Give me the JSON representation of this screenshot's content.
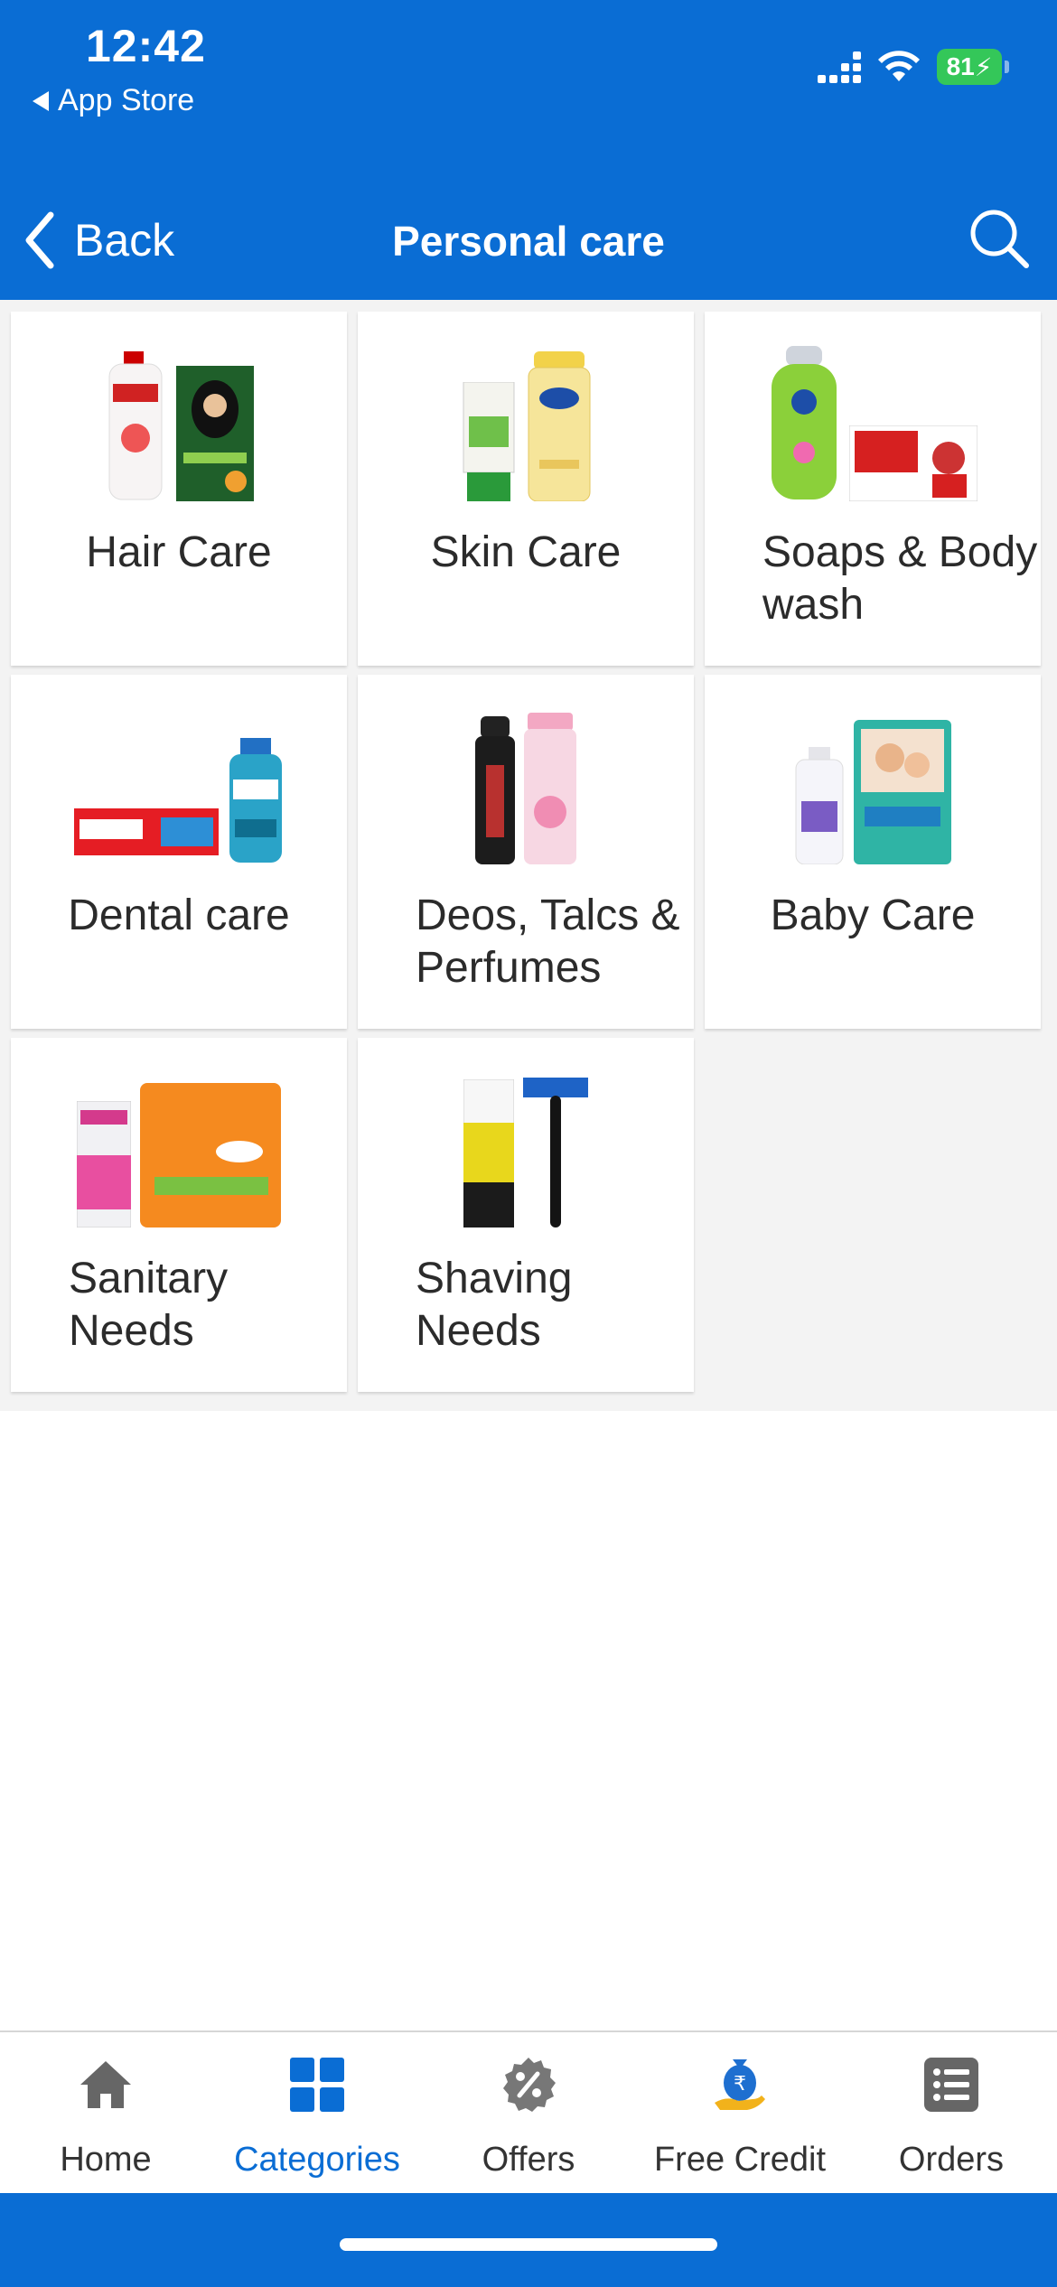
{
  "status_bar": {
    "time": "12:42",
    "back_app": "App Store",
    "battery": "81"
  },
  "navbar": {
    "back_label": "Back",
    "title": "Personal care",
    "search_icon": "search-icon"
  },
  "categories": [
    {
      "label": "Hair Care"
    },
    {
      "label": "Skin Care"
    },
    {
      "label": "Soaps & Body wash"
    },
    {
      "label": "Dental care"
    },
    {
      "label": "Deos, Talcs & Perfumes"
    },
    {
      "label": "Baby Care"
    },
    {
      "label": "Sanitary Needs"
    },
    {
      "label": "Shaving Needs"
    }
  ],
  "tabbar": {
    "active_tab": "Categories",
    "tabs": [
      {
        "label": "Home",
        "icon": "home-icon"
      },
      {
        "label": "Categories",
        "icon": "categories-icon"
      },
      {
        "label": "Offers",
        "icon": "percent-badge-icon"
      },
      {
        "label": "Free Credit",
        "icon": "rupee-bag-icon"
      },
      {
        "label": "Orders",
        "icon": "list-icon"
      }
    ]
  },
  "colors": {
    "brand_blue": "#0a6dd4",
    "active_tab": "#0a6dd4",
    "inactive_tab": "#666666",
    "battery_green": "#34c759"
  }
}
